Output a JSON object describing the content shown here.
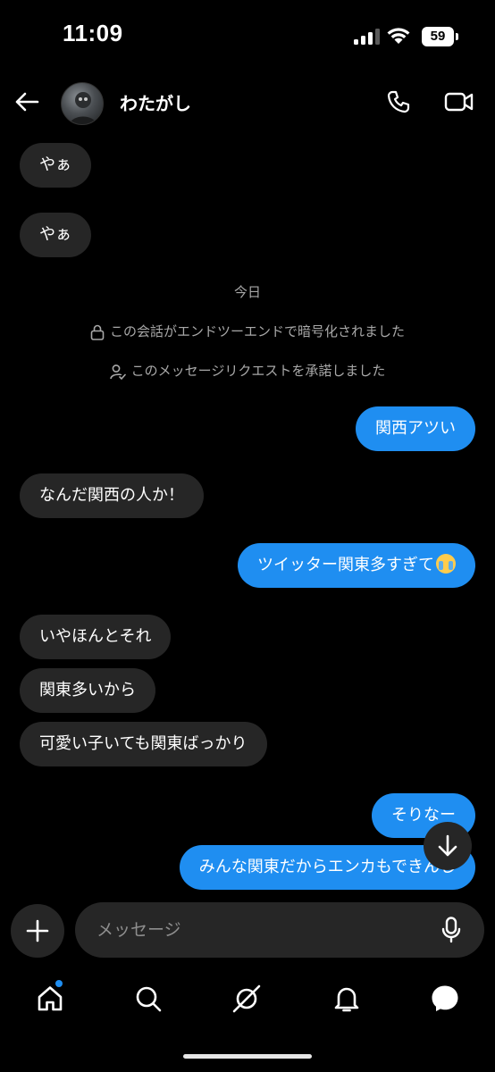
{
  "status_bar": {
    "time": "11:09",
    "battery": "59"
  },
  "header": {
    "contact_name": "わたがし"
  },
  "messages": [
    {
      "side": "in",
      "text": "やぁ"
    },
    {
      "side": "in",
      "text": "やぁ"
    },
    {
      "side": "out",
      "text": "関西アツい"
    },
    {
      "side": "in",
      "text": "なんだ関西の人か！"
    },
    {
      "side": "out",
      "text": "ツイッター関東多すぎて",
      "emoji": "loudly-crying-face"
    },
    {
      "side": "in",
      "text": "いやほんとそれ"
    },
    {
      "side": "in",
      "text": "関東多いから"
    },
    {
      "side": "in",
      "text": "可愛い子いても関東ばっかり"
    },
    {
      "side": "out",
      "text": "そりなー"
    },
    {
      "side": "out",
      "text": "みんな関東だからエンカもできんし"
    }
  ],
  "system": {
    "date_label": "今日",
    "encrypted_notice": "この会話がエンドツーエンドで暗号化されました",
    "request_notice": "このメッセージリクエストを承諾しました"
  },
  "composer": {
    "placeholder": "メッセージ"
  },
  "icons": {
    "back": "arrow-left-icon",
    "call": "phone-icon",
    "video": "video-camera-icon",
    "lock": "lock-icon",
    "person": "person-check-icon",
    "scroll": "arrow-down-icon",
    "plus": "plus-icon",
    "mic": "microphone-icon",
    "nav": [
      "home-icon",
      "search-icon",
      "explore-icon",
      "bell-icon",
      "chat-icon"
    ]
  },
  "colors": {
    "background": "#000000",
    "incoming_bubble": "#262626",
    "outgoing_bubble": "#1f8ef1",
    "secondary_text": "#a8a8a8"
  }
}
